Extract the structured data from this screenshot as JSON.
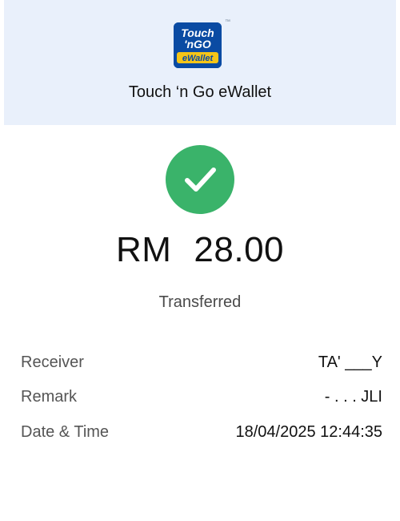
{
  "header": {
    "logo": {
      "name": "touch-n-go-ewallet-logo",
      "text_line1": "Touch",
      "text_line2": "'nGO",
      "text_line3": "eWallet",
      "tm": "™",
      "colors": {
        "background": "#0a4ba3",
        "text": "#ffffff",
        "accent": "#f5c518"
      }
    },
    "app_name": "Touch ‘n Go eWallet"
  },
  "receipt": {
    "status_icon": "check-icon",
    "status_color": "#3ab36a",
    "currency": "RM",
    "amount": "28.00",
    "status_text": "Transferred"
  },
  "details": [
    {
      "label": "Receiver",
      "value": "TA' ___Y"
    },
    {
      "label": "Remark",
      "value": "- . . . JLI"
    },
    {
      "label": "Date & Time",
      "value": "18/04/2025 12:44:35"
    }
  ]
}
